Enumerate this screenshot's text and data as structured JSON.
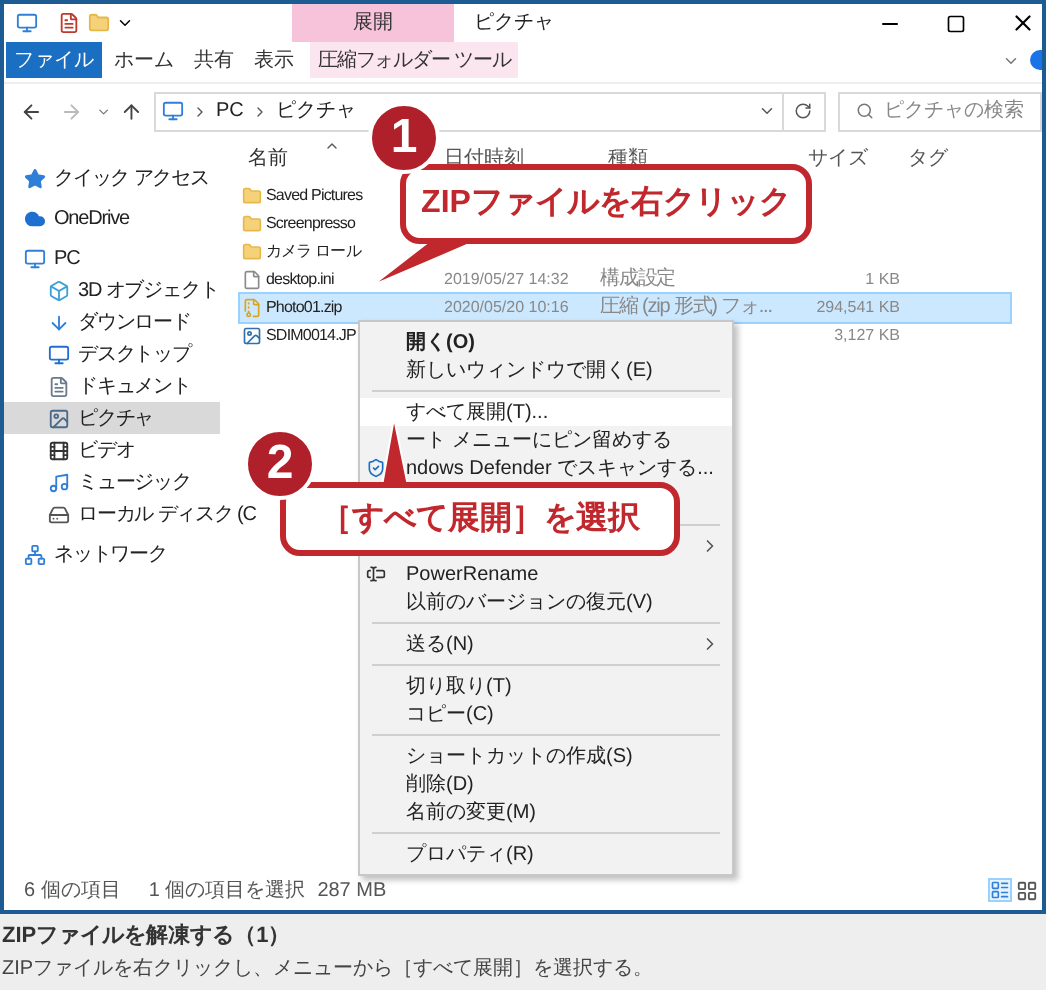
{
  "window": {
    "context_tab": "展開",
    "title": "ピクチャ"
  },
  "ribbon_tabs": [
    {
      "label": "ファイル",
      "kind": "file"
    },
    {
      "label": "ホーム",
      "kind": "normal"
    },
    {
      "label": "共有",
      "kind": "normal"
    },
    {
      "label": "表示",
      "kind": "normal"
    },
    {
      "label": "圧縮フォルダー ツール",
      "kind": "context"
    }
  ],
  "address": {
    "path": [
      "PC",
      "ピクチャ"
    ]
  },
  "search": {
    "placeholder": "ピクチャの検索"
  },
  "columns": [
    {
      "label": "名前",
      "sorted": true
    },
    {
      "label": "日付時刻",
      "sorted": false
    },
    {
      "label": "種類",
      "sorted": false
    },
    {
      "label": "サイズ",
      "sorted": false
    },
    {
      "label": "タグ",
      "sorted": false
    }
  ],
  "nav": [
    {
      "label": "クイック アクセス",
      "kind": "star",
      "selected": false
    },
    {
      "label": "OneDrive",
      "kind": "cloud",
      "selected": false
    },
    {
      "label": "PC",
      "kind": "pc",
      "selected": false,
      "children": [
        {
          "label": "3D オブジェクト",
          "kind": "cube",
          "selected": false
        },
        {
          "label": "ダウンロード",
          "kind": "download",
          "selected": false
        },
        {
          "label": "デスクトップ",
          "kind": "desktop",
          "selected": false
        },
        {
          "label": "ドキュメント",
          "kind": "document",
          "selected": false
        },
        {
          "label": "ピクチャ",
          "kind": "pictures",
          "selected": true
        },
        {
          "label": "ビデオ",
          "kind": "video",
          "selected": false
        },
        {
          "label": "ミュージック",
          "kind": "music",
          "selected": false
        },
        {
          "label": "ローカル ディスク (C",
          "kind": "disk",
          "selected": false
        }
      ]
    },
    {
      "label": "ネットワーク",
      "kind": "network",
      "selected": false
    }
  ],
  "files": [
    {
      "name": "Saved Pictures",
      "kind": "folder",
      "selected": false
    },
    {
      "name": "Screenpresso",
      "kind": "folder",
      "selected": false
    },
    {
      "name": "カメラ ロール",
      "kind": "folder",
      "selected": false
    },
    {
      "name": "desktop.ini",
      "kind": "settings",
      "date": "2019/05/27 14:32",
      "type": "構成設定",
      "size": "1 KB",
      "selected": false
    },
    {
      "name": "Photo01.zip",
      "kind": "zip",
      "date": "2020/05/20 10:16",
      "type": "圧縮 (zip 形式) フォ...",
      "size": "294,541 KB",
      "selected": true
    },
    {
      "name": "SDIM0014.JP",
      "kind": "image",
      "size": "3,127 KB",
      "selected": false
    }
  ],
  "context_menu": [
    {
      "kind": "item",
      "label": "開く(O)",
      "bold": true,
      "selected": false
    },
    {
      "kind": "item",
      "label": "新しいウィンドウで開く(E)",
      "bold": false,
      "selected": false
    },
    {
      "kind": "separator"
    },
    {
      "kind": "item",
      "label": "すべて展開(T)...",
      "bold": false,
      "selected": true
    },
    {
      "kind": "item",
      "label": "ート メニューにピン留めする",
      "bold": false,
      "selected": false
    },
    {
      "kind": "item",
      "label": "ndows Defender でスキャンする...",
      "bold": false,
      "selected": false
    },
    {
      "kind": "separator"
    },
    {
      "kind": "submenu",
      "selected": false
    },
    {
      "kind": "item",
      "label": "PowerRename",
      "bold": false,
      "selected": false
    },
    {
      "kind": "item",
      "label": "以前のバージョンの復元(V)",
      "bold": false,
      "selected": false
    },
    {
      "kind": "separator"
    },
    {
      "kind": "submenu",
      "label": "送る(N)",
      "bold": false,
      "selected": false
    },
    {
      "kind": "separator"
    },
    {
      "kind": "item",
      "label": "切り取り(T)",
      "bold": false,
      "selected": false
    },
    {
      "kind": "item",
      "label": "コピー(C)",
      "bold": false,
      "selected": false
    },
    {
      "kind": "separator"
    },
    {
      "kind": "item",
      "label": "ショートカットの作成(S)",
      "bold": false,
      "selected": false
    },
    {
      "kind": "item",
      "label": "削除(D)",
      "bold": false,
      "selected": false
    },
    {
      "kind": "item",
      "label": "名前の変更(M)",
      "bold": false,
      "selected": false
    },
    {
      "kind": "separator"
    },
    {
      "kind": "item",
      "label": "プロパティ(R)",
      "bold": false,
      "selected": false
    }
  ],
  "status": {
    "count": "6 個の項目",
    "selection": "1 個の項目を選択",
    "selection_size": "287 MB"
  },
  "callouts": [
    {
      "number": "1",
      "text": "ZIPファイルを右クリック"
    },
    {
      "number": "2",
      "text": "［すべて展開］を選択"
    }
  ],
  "caption": {
    "title": "ZIPファイルを解凍する（1）",
    "text": "ZIPファイルを右クリックし、メニューから［すべて展開］を選択する。"
  }
}
